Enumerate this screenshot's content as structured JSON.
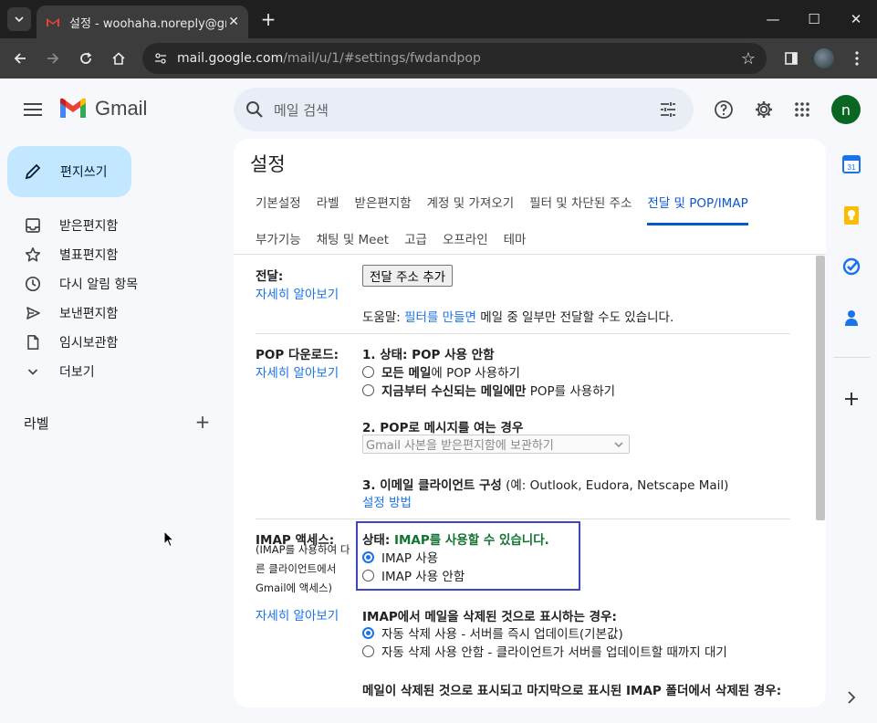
{
  "browser": {
    "tab_title": "설정 - woohaha.noreply@gmail.com",
    "url_domain": "mail.google.com",
    "url_path": "/mail/u/1/#settings/fwdandpop"
  },
  "header": {
    "app_name": "Gmail",
    "search_placeholder": "메일 검색",
    "avatar_initial": "n"
  },
  "sidebar": {
    "compose_label": "편지쓰기",
    "items": [
      {
        "label": "받은편지함",
        "icon": "inbox-icon"
      },
      {
        "label": "별표편지함",
        "icon": "star-icon"
      },
      {
        "label": "다시 알림 항목",
        "icon": "clock-icon"
      },
      {
        "label": "보낸편지함",
        "icon": "send-icon"
      },
      {
        "label": "임시보관함",
        "icon": "draft-icon"
      },
      {
        "label": "더보기",
        "icon": "chevron-down-icon"
      }
    ],
    "labels_title": "라벨"
  },
  "settings": {
    "title": "설정",
    "tabs_row1": [
      "기본설정",
      "라벨",
      "받은편지함",
      "계정 및 가져오기",
      "필터 및 차단된 주소",
      "전달 및 POP/IMAP"
    ],
    "tabs_row2": [
      "부가기능",
      "채팅 및 Meet",
      "고급",
      "오프라인",
      "테마"
    ],
    "active_tab": "전달 및 POP/IMAP",
    "learn_more": "자세히 알아보기",
    "forwarding": {
      "label": "전달:",
      "add_button": "전달 주소 추가",
      "tip_prefix": "도움말: ",
      "tip_link": "필터를 만들면",
      "tip_suffix": " 메일 중 일부만 전달할 수도 있습니다."
    },
    "pop": {
      "label": "POP 다운로드:",
      "status_prefix": "1. 상태: ",
      "status_value": "POP 사용 안함",
      "option1_bold": "모든 메일",
      "option1_rest": "에 POP 사용하기",
      "option2_bold": "지금부터 수신되는 메일에만",
      "option2_rest": " POP를 사용하기",
      "when_opened": "2. POP로 메시지를 여는 경우",
      "select_value": "Gmail 사본을 받은편지함에 보관하기",
      "client_title": "3. 이메일 클라이언트 구성",
      "client_example": " (예: Outlook, Eudora, Netscape Mail)",
      "setup_link": "설정 방법"
    },
    "imap": {
      "label": "IMAP 액세스:",
      "note": "(IMAP를 사용하여 다른 클라이언트에서 Gmail에 액세스)",
      "status_prefix": "상태: ",
      "status_value": "IMAP를 사용할 수 있습니다.",
      "enable": "IMAP 사용",
      "disable": "IMAP 사용 안함",
      "selected": "enable",
      "delete_title": "IMAP에서 메일을 삭제된 것으로 표시하는 경우:",
      "auto_expunge_on": "자동 삭제 사용 - 서버를 즉시 업데이트(기본값)",
      "auto_expunge_off": "자동 삭제 사용 안함 - 클라이언트가 서버를 업데이트할 때까지 대기",
      "expunged_title": "메일이 삭제된 것으로 표시되고 마지막으로 표시된 IMAP 폴더에서 삭제된 경우:"
    }
  },
  "colors": {
    "accent": "#0b57d0",
    "link": "#1a73e8",
    "status_green": "#137333",
    "compose_bg": "#c2e7ff",
    "highlight_box": "#3b46c4"
  }
}
